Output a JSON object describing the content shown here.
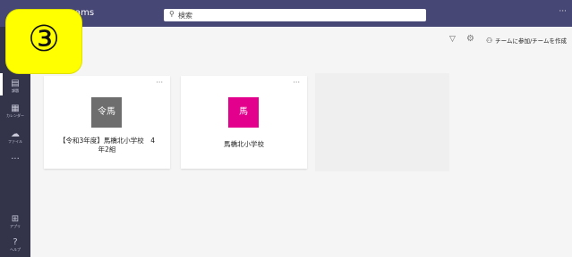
{
  "header": {
    "app_title": "ams",
    "search_placeholder": "検索",
    "more": "···"
  },
  "overlay": {
    "marker": "③"
  },
  "rail": {
    "items": [
      {
        "icon": "assignments-icon",
        "glyph": "▤",
        "label": "課題"
      },
      {
        "icon": "calendar-icon",
        "glyph": "▦",
        "label": "カレンダー"
      },
      {
        "icon": "files-icon",
        "glyph": "☁",
        "label": "ファイル"
      },
      {
        "icon": "more-apps-icon",
        "glyph": "···",
        "label": ""
      },
      {
        "icon": "apps-icon",
        "glyph": "⊞",
        "label": "アプリ"
      },
      {
        "icon": "help-icon",
        "glyph": "?",
        "label": "ヘルプ"
      }
    ]
  },
  "toolbar": {
    "join_create_label": "チームに参加/チームを作成"
  },
  "teams": [
    {
      "avatar_text": "令馬",
      "avatar_color": "#6e6e6e",
      "name_line1": "【令和3年度】馬橋北小学校　4",
      "name_line2": "年2組",
      "menu": "···"
    },
    {
      "avatar_text": "馬",
      "avatar_color": "#e3008c",
      "name_line1": "馬橋北小学校",
      "name_line2": "",
      "menu": "···"
    }
  ]
}
